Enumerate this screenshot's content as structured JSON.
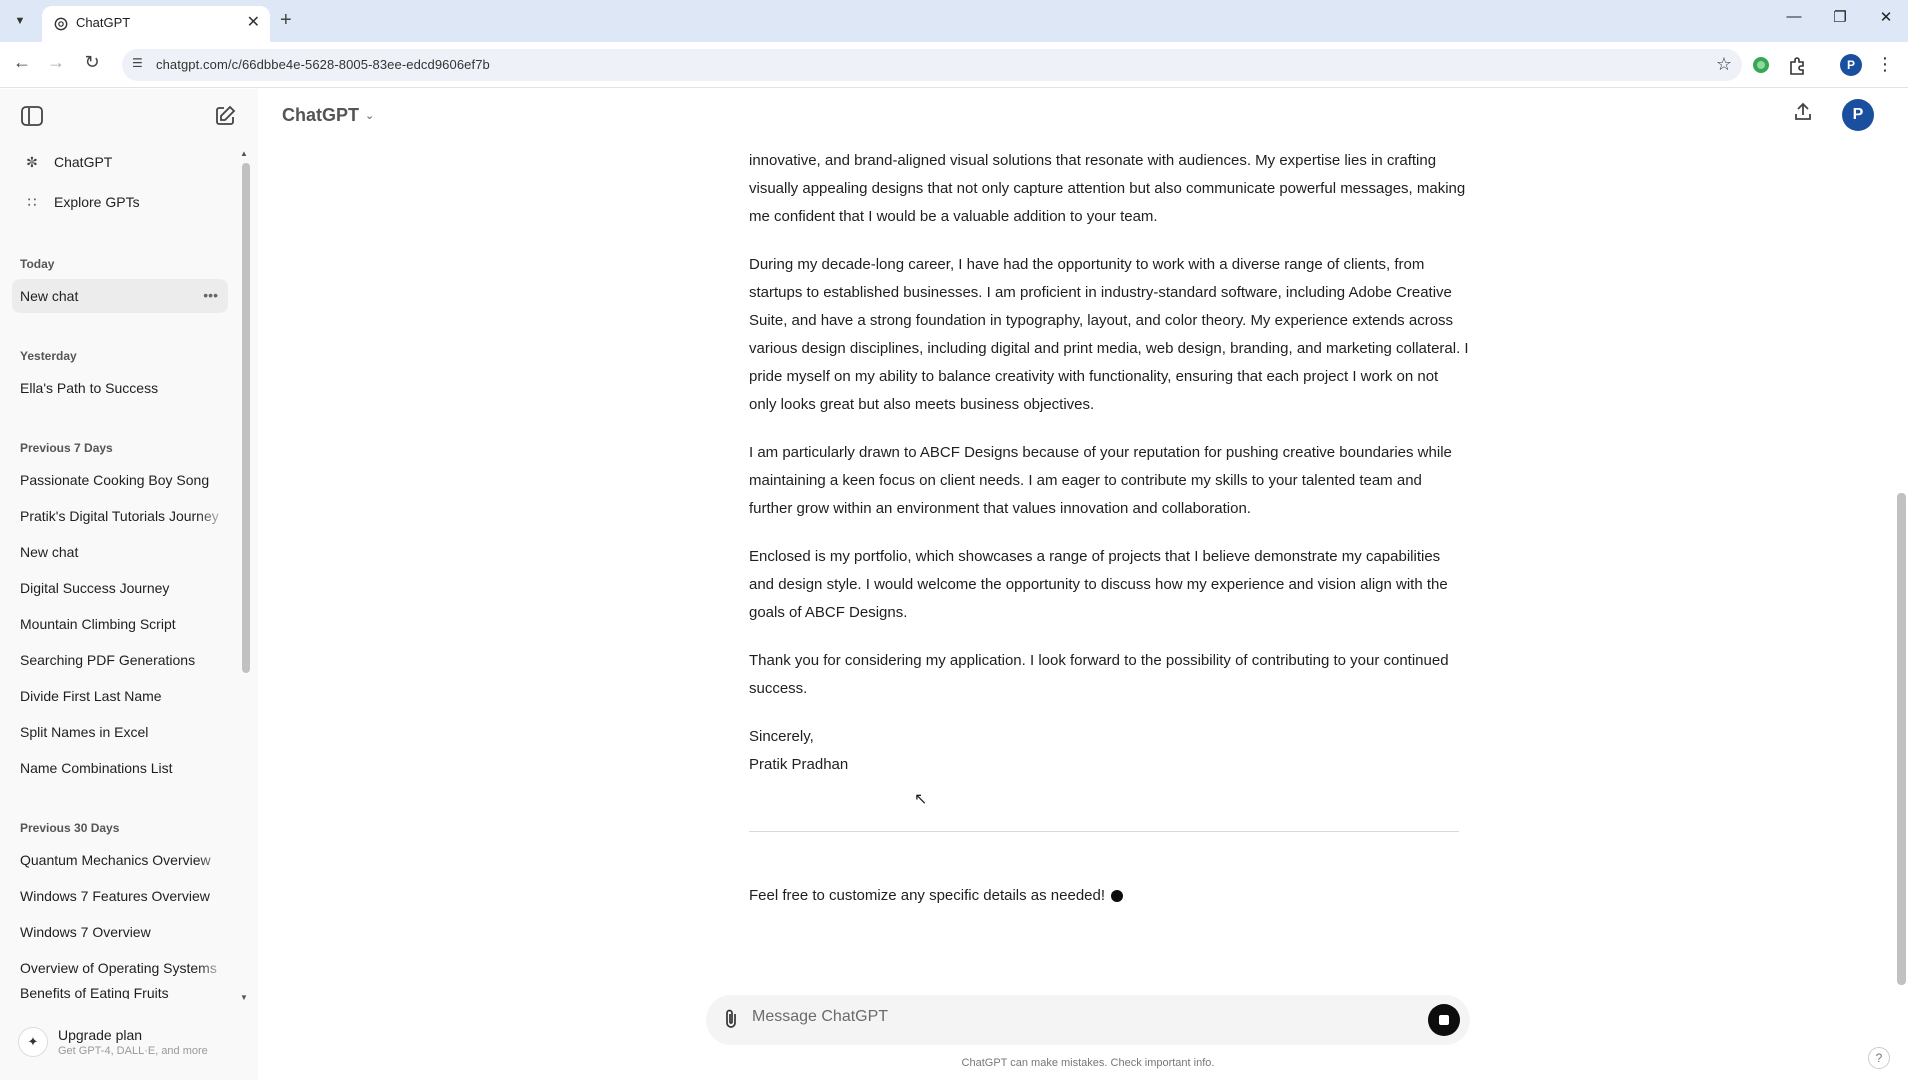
{
  "browser": {
    "tab_title": "ChatGPT",
    "url": "chatgpt.com/c/66dbbe4e-5628-8005-83ee-edcd9606ef7b",
    "profile_initial": "P"
  },
  "sidebar": {
    "top_items": [
      {
        "label": "ChatGPT",
        "icon": "chatgpt-logo-icon"
      },
      {
        "label": "Explore GPTs",
        "icon": "grid-icon"
      }
    ],
    "sections": [
      {
        "title": "Today",
        "items": [
          "New chat"
        ]
      },
      {
        "title": "Yesterday",
        "items": [
          "Ella's Path to Success"
        ]
      },
      {
        "title": "Previous 7 Days",
        "items": [
          "Passionate Cooking Boy Song",
          "Pratik's Digital Tutorials Journey",
          "New chat",
          "Digital Success Journey",
          "Mountain Climbing Script",
          "Searching PDF Generations",
          "Divide First Last Name",
          "Split Names in Excel",
          "Name Combinations List"
        ]
      },
      {
        "title": "Previous 30 Days",
        "items": [
          "Quantum Mechanics Overview",
          "Windows 7 Features Overview",
          "Windows 7 Overview",
          "Overview of Operating Systems",
          "Benefits of Eating Fruits"
        ]
      }
    ],
    "upgrade": {
      "title": "Upgrade plan",
      "subtitle": "Get GPT-4, DALL·E, and more"
    }
  },
  "main": {
    "model_label": "ChatGPT",
    "avatar_initial": "P",
    "paragraphs": [
      "innovative, and brand-aligned visual solutions that resonate with audiences. My expertise lies in crafting visually appealing designs that not only capture attention but also communicate powerful messages, making me confident that I would be a valuable addition to your team.",
      "During my decade-long career, I have had the opportunity to work with a diverse range of clients, from startups to established businesses. I am proficient in industry-standard software, including Adobe Creative Suite, and have a strong foundation in typography, layout, and color theory. My experience extends across various design disciplines, including digital and print media, web design, branding, and marketing collateral. I pride myself on my ability to balance creativity with functionality, ensuring that each project I work on not only looks great but also meets business objectives.",
      "I am particularly drawn to ABCF Designs because of your reputation for pushing creative boundaries while maintaining a keen focus on client needs. I am eager to contribute my skills to your talented team and further grow within an environment that values innovation and collaboration.",
      "Enclosed is my portfolio, which showcases a range of projects that I believe demonstrate my capabilities and design style. I would welcome the opportunity to discuss how my experience and vision align with the goals of ABCF Designs.",
      "Thank you for considering my application. I look forward to the possibility of contributing to your continued success."
    ],
    "signoff": "Sincerely,",
    "signature": "Pratik Pradhan",
    "closing": "Feel free to customize any specific details as needed!"
  },
  "composer": {
    "placeholder": "Message ChatGPT",
    "disclaimer": "ChatGPT can make mistakes. Check important info."
  }
}
